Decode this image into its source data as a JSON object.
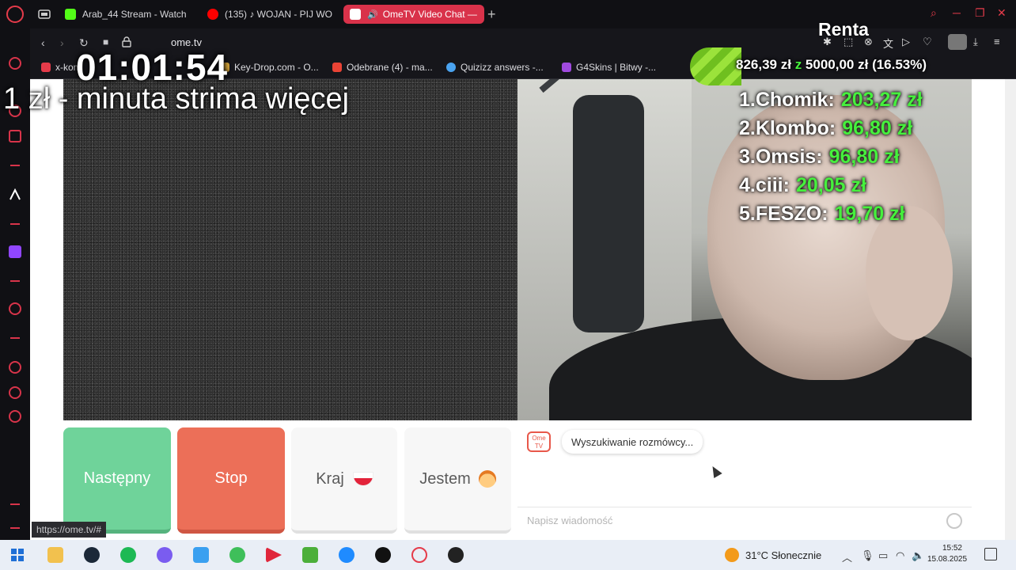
{
  "browser": {
    "tabs": [
      {
        "label": "Arab_44 Stream - Watch",
        "color": "#53fc18",
        "active": false
      },
      {
        "label": "(135) ♪ WOJAN - PIJ WO",
        "color": "#ff0000",
        "active": false
      },
      {
        "label": "OmeTV Video Chat —",
        "color": "#ffffff",
        "active": true
      }
    ],
    "new_tab": "+",
    "url": "ome.tv",
    "bookmarks": [
      {
        "label": "x-kom",
        "color": "#e53b4a"
      },
      {
        "label": "Key-Drop.com - O...",
        "color": "#d2a23a"
      },
      {
        "label": "Odebrane (4) - ma...",
        "color": "#ea4335"
      },
      {
        "label": "Quizizz answers -...",
        "color": "#4aa3f0"
      },
      {
        "label": "G4Skins | Bitwy -...",
        "color": "#a04adf"
      }
    ],
    "status_url": "https://ome.tv/#"
  },
  "ometv": {
    "buttons": {
      "next": "Następny",
      "stop": "Stop",
      "country": "Kraj",
      "gender": "Jestem"
    },
    "chat": {
      "logo_text": "Ome TV",
      "searching": "Wyszukiwanie rozmówcy...",
      "input_placeholder": "Napisz wiadomość"
    }
  },
  "overlay": {
    "timer": "01:01:54",
    "promo": "1 zł - minuta strima więcej",
    "renta_label": "Renta",
    "goal": {
      "current": "826,39 zł",
      "connector": "z",
      "target": "5000,00 zł",
      "percent": "(16.53%)",
      "progress_fraction": 0.1653
    },
    "top_donors": [
      {
        "rank": "1.",
        "name": "Chomik:",
        "amount": "203,27 zł"
      },
      {
        "rank": "2.",
        "name": "Klombo:",
        "amount": "96,80 zł"
      },
      {
        "rank": "3.",
        "name": "Omsis:",
        "amount": "96,80 zł"
      },
      {
        "rank": "4.",
        "name": "ciii:",
        "amount": "20,05 zł"
      },
      {
        "rank": "5.",
        "name": "FESZO:",
        "amount": "19,70 zł"
      }
    ],
    "accent_green": "#46f03d"
  },
  "taskbar": {
    "weather": "31°C  Słonecznie",
    "time": "15:52",
    "date": "15.08.2025"
  }
}
